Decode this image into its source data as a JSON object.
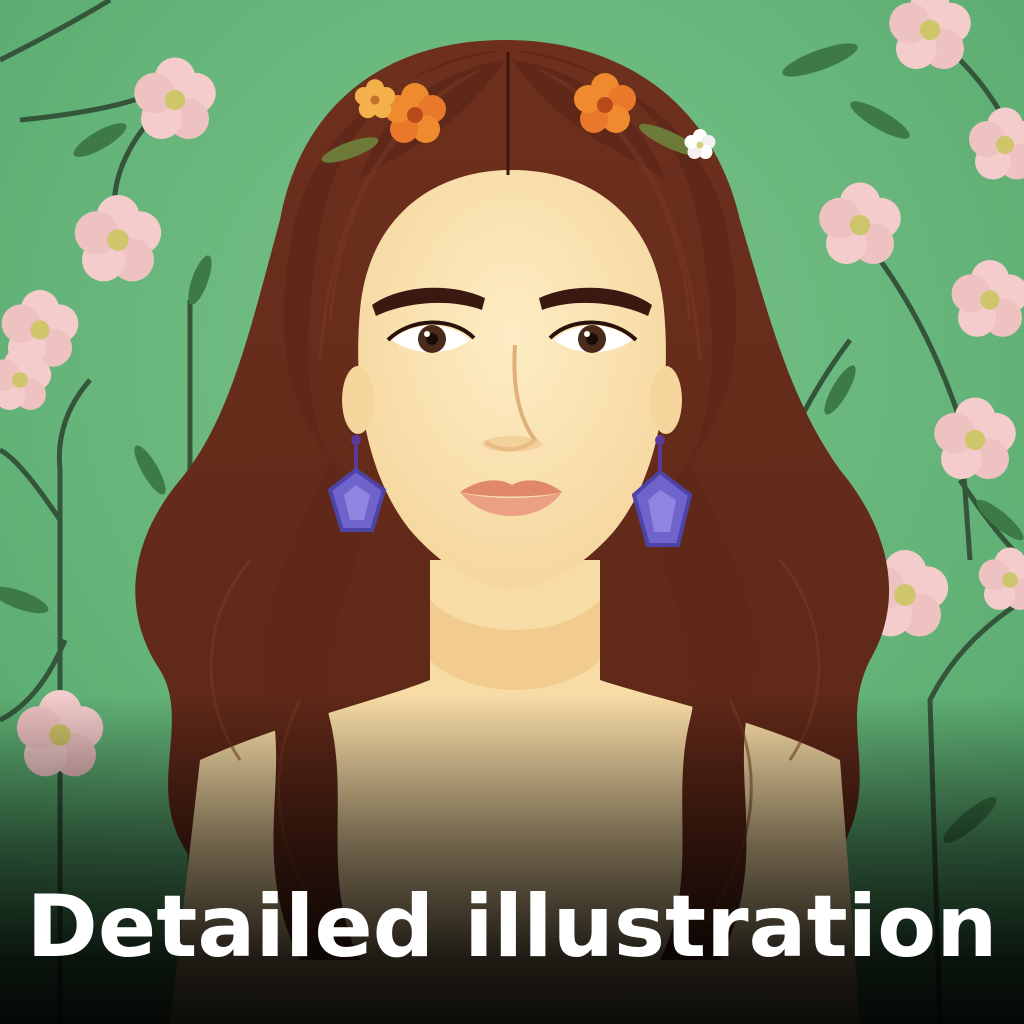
{
  "image": {
    "description_icon": "portrait-illustration",
    "colors": {
      "background": "#5dae72",
      "background_light": "#78c28a",
      "hair": "#6b2e1c",
      "hair_dark": "#4e1f12",
      "skin": "#fbe4b4",
      "skin_shadow": "#f2cf96",
      "eyebrow": "#3a1a10",
      "lips": "#e89a7c",
      "earring": "#6a5fc7",
      "blossom": "#f2c9c9",
      "blossom_center": "#c9c46a",
      "hair_flower": "#e9782a",
      "stem": "#3b5a3a",
      "caption_text": "#ffffff"
    }
  },
  "caption": {
    "text": "Detailed illustration"
  }
}
